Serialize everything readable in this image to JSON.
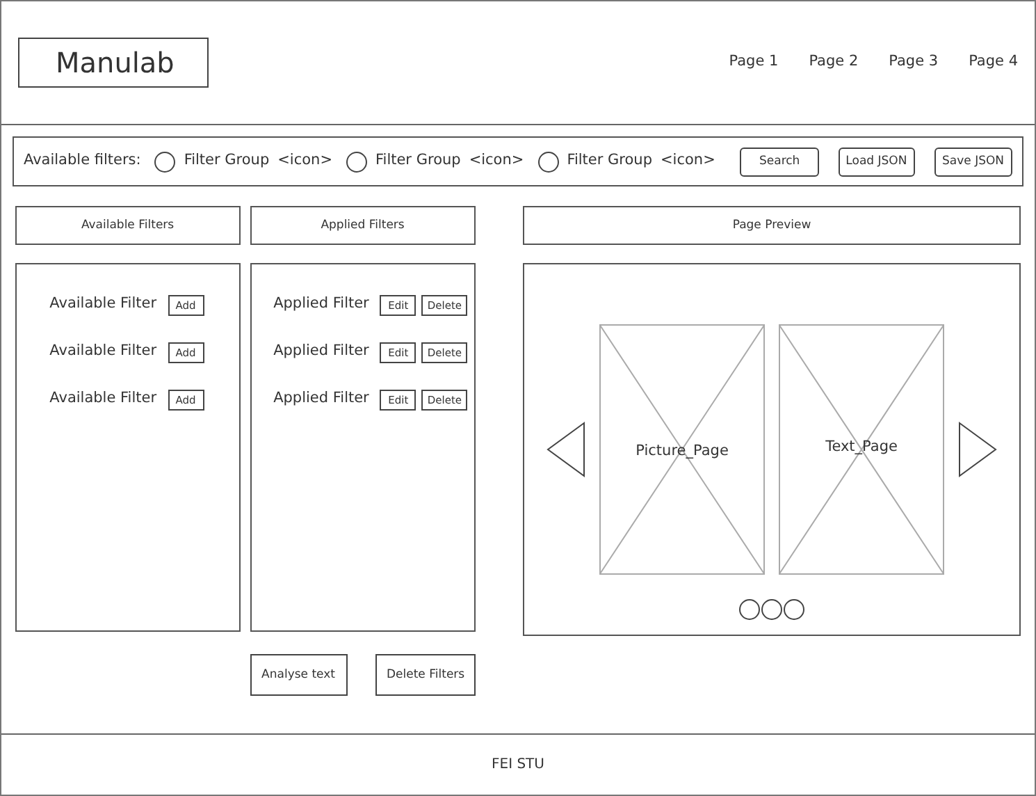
{
  "header": {
    "logo": "Manulab",
    "nav": [
      {
        "label": "Page 1"
      },
      {
        "label": "Page 2"
      },
      {
        "label": "Page 3"
      },
      {
        "label": "Page 4"
      }
    ]
  },
  "filter_bar": {
    "label": "Available filters:",
    "groups": [
      {
        "label": "Filter Group",
        "icon_text": "<icon>",
        "selected": false
      },
      {
        "label": "Filter Group",
        "icon_text": "<icon>",
        "selected": false
      },
      {
        "label": "Filter Group",
        "icon_text": "<icon>",
        "selected": false
      }
    ],
    "buttons": [
      "Search",
      "Load JSON",
      "Save JSON"
    ]
  },
  "available": {
    "title": "Available Filters",
    "items": [
      {
        "label": "Available Filter",
        "buttons": [
          "Add"
        ]
      },
      {
        "label": "Available Filter",
        "buttons": [
          "Add"
        ]
      },
      {
        "label": "Available Filter",
        "buttons": [
          "Add"
        ]
      }
    ]
  },
  "applied": {
    "title": "Applied Filters",
    "items": [
      {
        "label": "Applied Filter",
        "buttons": [
          "Edit",
          "Delete"
        ]
      },
      {
        "label": "Applied Filter",
        "buttons": [
          "Edit",
          "Delete"
        ]
      },
      {
        "label": "Applied Filter",
        "buttons": [
          "Edit",
          "Delete"
        ]
      }
    ],
    "buttons": [
      "Analyse text",
      "Delete Filters"
    ]
  },
  "preview": {
    "title": "Page Preview",
    "pages": [
      {
        "label": "Picture_Page"
      },
      {
        "label": "Text_Page"
      }
    ]
  },
  "footer": {
    "text": "FEI STU"
  }
}
